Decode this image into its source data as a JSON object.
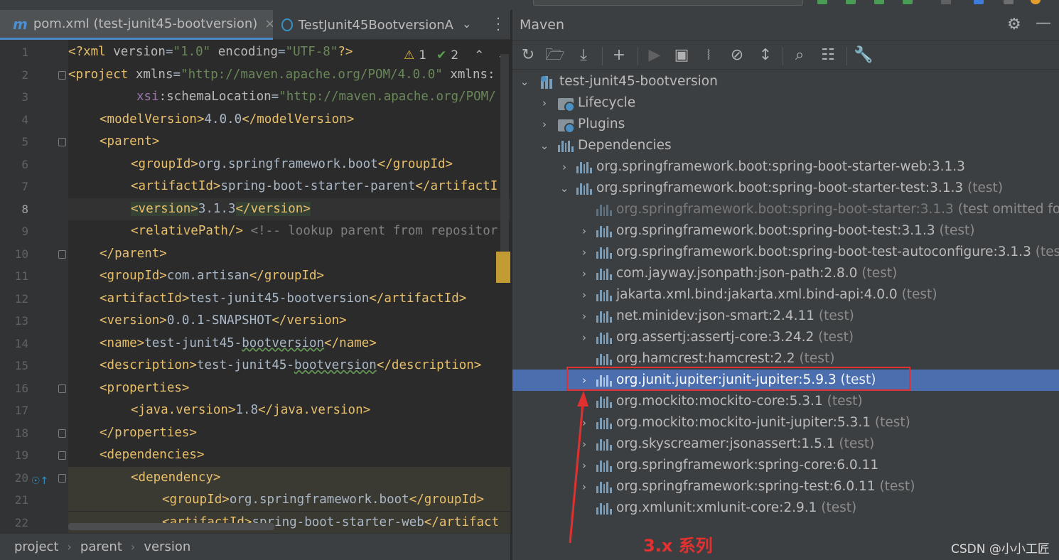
{
  "editor": {
    "tabs": [
      {
        "label": "pom.xml (test-junit45-bootversion)",
        "close": "×"
      },
      {
        "label": "TestJunit45BootversionA"
      }
    ],
    "inspection": {
      "warnings": "1",
      "checks": "2"
    },
    "line_numbers": [
      "1",
      "2",
      "3",
      "4",
      "5",
      "6",
      "7",
      "8",
      "9",
      "10",
      "11",
      "12",
      "13",
      "14",
      "15",
      "16",
      "17",
      "18",
      "19",
      "20",
      "21",
      "22"
    ],
    "lines": {
      "l1": {
        "open": "<?xml ",
        "a1": "version",
        "e1": "=",
        "v1": "\"1.0\"",
        "a2": " encoding",
        "e2": "=",
        "v2": "\"UTF-8\"",
        "close": "?>"
      },
      "l2": {
        "open": "<project ",
        "a1": "xmlns",
        "e1": "=",
        "v1": "\"http://maven.apache.org/POM/4.0.0\"",
        "a2": " xmlns:"
      },
      "l3": {
        "ns": "xsi",
        "a1": ":schemaLocation",
        "e1": "=",
        "v1": "\"http://maven.apache.org/POM/"
      },
      "l4": {
        "o": "<modelVersion>",
        "t": "4.0.0",
        "c": "</modelVersion>"
      },
      "l5": {
        "o": "<parent>"
      },
      "l6": {
        "o": "<groupId>",
        "t": "org.springframework.boot",
        "c": "</groupId>"
      },
      "l7": {
        "o": "<artifactId>",
        "t": "spring-boot-starter-parent",
        "c": "</artifactI"
      },
      "l8": {
        "o": "<version>",
        "t": "3.1.3",
        "c": "</version>"
      },
      "l9": {
        "o": "<relativePath/>",
        "cm": " <!-- lookup parent from repositor"
      },
      "l10": {
        "o": "</parent>"
      },
      "l11": {
        "o": "<groupId>",
        "t": "com.artisan",
        "c": "</groupId>"
      },
      "l12": {
        "o": "<artifactId>",
        "t": "test-junit45-bootversion",
        "c": "</artifactId>"
      },
      "l13": {
        "o": "<version>",
        "t": "0.0.1-SNAPSHOT",
        "c": "</version>"
      },
      "l14": {
        "o": "<name>",
        "t1": "test-junit45-",
        "t2": "bootversion",
        "c": "</name>"
      },
      "l15": {
        "o": "<description>",
        "t1": "test-junit45-",
        "t2": "bootversion",
        "c": "</description>"
      },
      "l16": {
        "o": "<properties>"
      },
      "l17": {
        "o": "<java.version>",
        "t": "1.8",
        "c": "</java.version>"
      },
      "l18": {
        "o": "</properties>"
      },
      "l19": {
        "o": "<dependencies>"
      },
      "l20": {
        "o": "<dependency>"
      },
      "l21": {
        "o": "<groupId>",
        "t": "org.springframework.boot",
        "c": "</groupId>"
      },
      "l22": {
        "o": "<artifactId>",
        "t": "spring-boot-starter-web",
        "c": "</artifact"
      }
    },
    "breadcrumb": [
      "project",
      "parent",
      "version"
    ]
  },
  "maven": {
    "title": "Maven",
    "tree": {
      "root": "test-junit45-bootversion",
      "lifecycle": "Lifecycle",
      "plugins": "Plugins",
      "dependencies": "Dependencies",
      "deps": [
        {
          "label": "org.springframework.boot:spring-boot-starter-web:3.1.3",
          "scope": ""
        },
        {
          "label": "org.springframework.boot:spring-boot-starter-test:3.1.3",
          "scope": " (test)"
        },
        {
          "label": "org.springframework.boot:spring-boot-starter:3.1.3",
          "scope": " (test omitted for du"
        },
        {
          "label": "org.springframework.boot:spring-boot-test:3.1.3",
          "scope": " (test)"
        },
        {
          "label": "org.springframework.boot:spring-boot-test-autoconfigure:3.1.3",
          "scope": " (test)"
        },
        {
          "label": "com.jayway.jsonpath:json-path:2.8.0",
          "scope": " (test)"
        },
        {
          "label": "jakarta.xml.bind:jakarta.xml.bind-api:4.0.0",
          "scope": " (test)"
        },
        {
          "label": "net.minidev:json-smart:2.4.11",
          "scope": " (test)"
        },
        {
          "label": "org.assertj:assertj-core:3.24.2",
          "scope": " (test)"
        },
        {
          "label": "org.hamcrest:hamcrest:2.2",
          "scope": " (test)"
        },
        {
          "label": "org.junit.jupiter:junit-jupiter:5.9.3",
          "scope": " (test)"
        },
        {
          "label": "org.mockito:mockito-core:5.3.1",
          "scope": " (test)"
        },
        {
          "label": "org.mockito:mockito-junit-jupiter:5.3.1",
          "scope": " (test)"
        },
        {
          "label": "org.skyscreamer:jsonassert:1.5.1",
          "scope": " (test)"
        },
        {
          "label": "org.springframework:spring-core:6.0.11",
          "scope": ""
        },
        {
          "label": "org.springframework:spring-test:6.0.11",
          "scope": " (test)"
        },
        {
          "label": "org.xmlunit:xmlunit-core:2.9.1",
          "scope": " (test)"
        }
      ]
    }
  },
  "annotation": {
    "text": "3.x 系列",
    "color": "#e53030"
  },
  "watermark": "CSDN @小小工匠",
  "colors": {
    "selection": "#4b6eaf",
    "xml_tag": "#e8bf6a",
    "xml_value": "#6a8759",
    "annotation": "#e53030"
  }
}
